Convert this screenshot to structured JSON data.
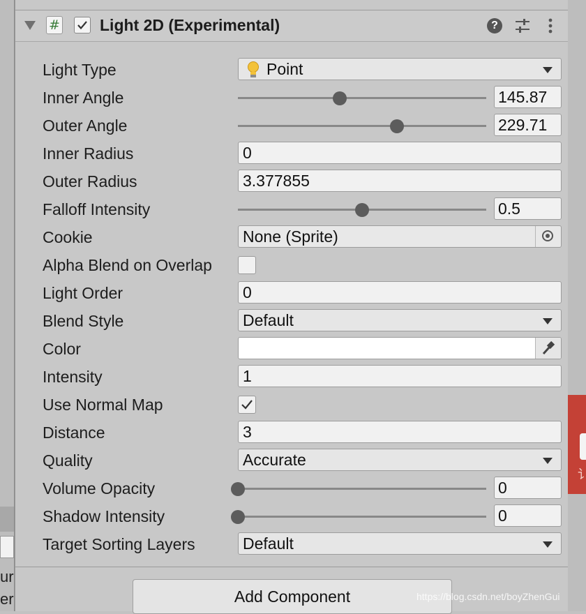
{
  "left_edge": {
    "line1": "ure",
    "line2": "er"
  },
  "right_edge": {
    "char": "讠"
  },
  "component": {
    "title": "Light 2D (Experimental)",
    "script_icon": "#",
    "enabled": true,
    "icons": [
      "help-icon",
      "presets-icon",
      "kebab-menu-icon"
    ],
    "help_glyph": "?"
  },
  "properties": {
    "light_type": {
      "label": "Light Type",
      "value": "Point",
      "icon": "lightbulb-icon"
    },
    "inner_angle": {
      "label": "Inner Angle",
      "value": "145.87",
      "fraction": 0.41
    },
    "outer_angle": {
      "label": "Outer Angle",
      "value": "229.71",
      "fraction": 0.64
    },
    "inner_radius": {
      "label": "Inner Radius",
      "value": "0"
    },
    "outer_radius": {
      "label": "Outer Radius",
      "value": "3.377855"
    },
    "falloff_intensity": {
      "label": "Falloff Intensity",
      "value": "0.5",
      "fraction": 0.5
    },
    "cookie": {
      "label": "Cookie",
      "value": "None (Sprite)"
    },
    "alpha_blend": {
      "label": "Alpha Blend on Overlap",
      "checked": false
    },
    "light_order": {
      "label": "Light Order",
      "value": "0"
    },
    "blend_style": {
      "label": "Blend Style",
      "value": "Default"
    },
    "color": {
      "label": "Color",
      "value": "#ffffff"
    },
    "intensity": {
      "label": "Intensity",
      "value": "1"
    },
    "use_normal_map": {
      "label": "Use Normal Map",
      "checked": true
    },
    "distance": {
      "label": "Distance",
      "value": "3"
    },
    "quality": {
      "label": "Quality",
      "value": "Accurate"
    },
    "volume_opacity": {
      "label": "Volume Opacity",
      "value": "0",
      "fraction": 0.0
    },
    "shadow_intensity": {
      "label": "Shadow Intensity",
      "value": "0",
      "fraction": 0.0
    },
    "target_sorting_layers": {
      "label": "Target Sorting Layers",
      "value": "Default"
    }
  },
  "add_component": {
    "label": "Add Component"
  },
  "watermark": {
    "text": "https://blog.csdn.net/boyZhenGui"
  },
  "colors": {
    "panel": "#c8c8c8",
    "field": "#f1f1f1",
    "accent_red": "#c44136",
    "slider_thumb": "#5c5c5c"
  }
}
